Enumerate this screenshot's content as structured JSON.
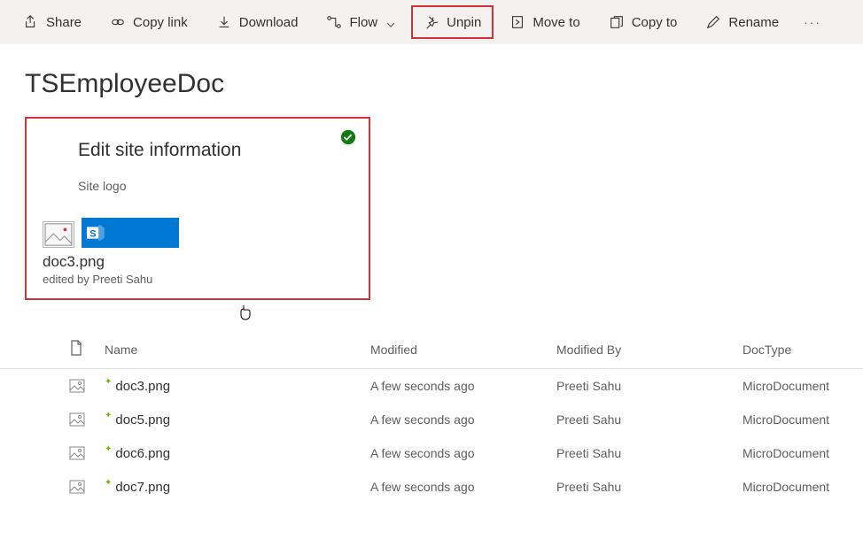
{
  "toolbar": {
    "share": "Share",
    "copylink": "Copy link",
    "download": "Download",
    "flow": "Flow",
    "unpin": "Unpin",
    "moveto": "Move to",
    "copyto": "Copy to",
    "rename": "Rename"
  },
  "page": {
    "title": "TSEmployeeDoc"
  },
  "card": {
    "title": "Edit site information",
    "subtitle": "Site logo",
    "filename": "doc3.png",
    "meta": "edited by Preeti Sahu"
  },
  "list": {
    "headers": {
      "name": "Name",
      "modified": "Modified",
      "modifiedby": "Modified By",
      "doctype": "DocType"
    },
    "rows": [
      {
        "name": "doc3.png",
        "modified": "A few seconds ago",
        "modifiedby": "Preeti Sahu",
        "doctype": "MicroDocument"
      },
      {
        "name": "doc5.png",
        "modified": "A few seconds ago",
        "modifiedby": "Preeti Sahu",
        "doctype": "MicroDocument"
      },
      {
        "name": "doc6.png",
        "modified": "A few seconds ago",
        "modifiedby": "Preeti Sahu",
        "doctype": "MicroDocument"
      },
      {
        "name": "doc7.png",
        "modified": "A few seconds ago",
        "modifiedby": "Preeti Sahu",
        "doctype": "MicroDocument"
      }
    ]
  }
}
